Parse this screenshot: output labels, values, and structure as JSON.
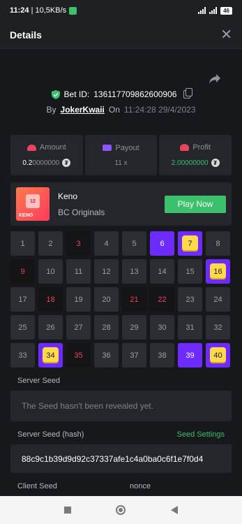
{
  "statusbar": {
    "time": "11:24",
    "speed": "10,5KB/s",
    "battery": "46"
  },
  "header": {
    "title": "Details",
    "close_label": "✕"
  },
  "bet": {
    "id_label": "Bet ID:",
    "id_value": "136117709862600906",
    "by_label": "By",
    "user": "JokerKwaii",
    "on_label": "On",
    "timestamp": "11:24:28 29/4/2023"
  },
  "stats": {
    "amount": {
      "label": "Amount",
      "value_main": "0.2",
      "value_dim": "0000000"
    },
    "payout": {
      "label": "Payout",
      "value": "11 x"
    },
    "profit": {
      "label": "Profit",
      "value": "2.00000000"
    }
  },
  "game": {
    "name": "Keno",
    "provider": "BC Originals",
    "play_label": "Play Now",
    "thumb_number": "12",
    "thumb_word": "KENO"
  },
  "grid": [
    {
      "n": "1",
      "s": "normal"
    },
    {
      "n": "2",
      "s": "normal"
    },
    {
      "n": "3",
      "s": "miss"
    },
    {
      "n": "4",
      "s": "normal"
    },
    {
      "n": "5",
      "s": "normal"
    },
    {
      "n": "6",
      "s": "pick"
    },
    {
      "n": "7",
      "s": "hit"
    },
    {
      "n": "8",
      "s": "normal"
    },
    {
      "n": "9",
      "s": "miss"
    },
    {
      "n": "10",
      "s": "normal"
    },
    {
      "n": "11",
      "s": "normal"
    },
    {
      "n": "12",
      "s": "normal"
    },
    {
      "n": "13",
      "s": "normal"
    },
    {
      "n": "14",
      "s": "normal"
    },
    {
      "n": "15",
      "s": "normal"
    },
    {
      "n": "16",
      "s": "hit"
    },
    {
      "n": "17",
      "s": "normal"
    },
    {
      "n": "18",
      "s": "miss"
    },
    {
      "n": "19",
      "s": "normal"
    },
    {
      "n": "20",
      "s": "normal"
    },
    {
      "n": "21",
      "s": "miss"
    },
    {
      "n": "22",
      "s": "miss"
    },
    {
      "n": "23",
      "s": "normal"
    },
    {
      "n": "24",
      "s": "normal"
    },
    {
      "n": "25",
      "s": "normal"
    },
    {
      "n": "26",
      "s": "normal"
    },
    {
      "n": "27",
      "s": "normal"
    },
    {
      "n": "28",
      "s": "normal"
    },
    {
      "n": "29",
      "s": "normal"
    },
    {
      "n": "30",
      "s": "normal"
    },
    {
      "n": "31",
      "s": "normal"
    },
    {
      "n": "32",
      "s": "normal"
    },
    {
      "n": "33",
      "s": "normal"
    },
    {
      "n": "34",
      "s": "hit"
    },
    {
      "n": "35",
      "s": "miss"
    },
    {
      "n": "36",
      "s": "normal"
    },
    {
      "n": "37",
      "s": "normal"
    },
    {
      "n": "38",
      "s": "normal"
    },
    {
      "n": "39",
      "s": "pick"
    },
    {
      "n": "40",
      "s": "hit"
    }
  ],
  "seeds": {
    "server_seed_label": "Server Seed",
    "server_seed_value": "The Seed hasn't been revealed yet.",
    "hash_label": "Server Seed (hash)",
    "settings_label": "Seed Settings",
    "hash_value": "88c9c1b39d9d92c37337afe1c4a0ba0c6f1e7f0d4",
    "client_seed_label": "Client Seed",
    "nonce_label": "nonce"
  },
  "colors": {
    "accent_green": "#3bc06b",
    "pick_purple": "#6d2bff",
    "miss_red": "#e8435f",
    "gem_yellow": "#ffd94a"
  }
}
